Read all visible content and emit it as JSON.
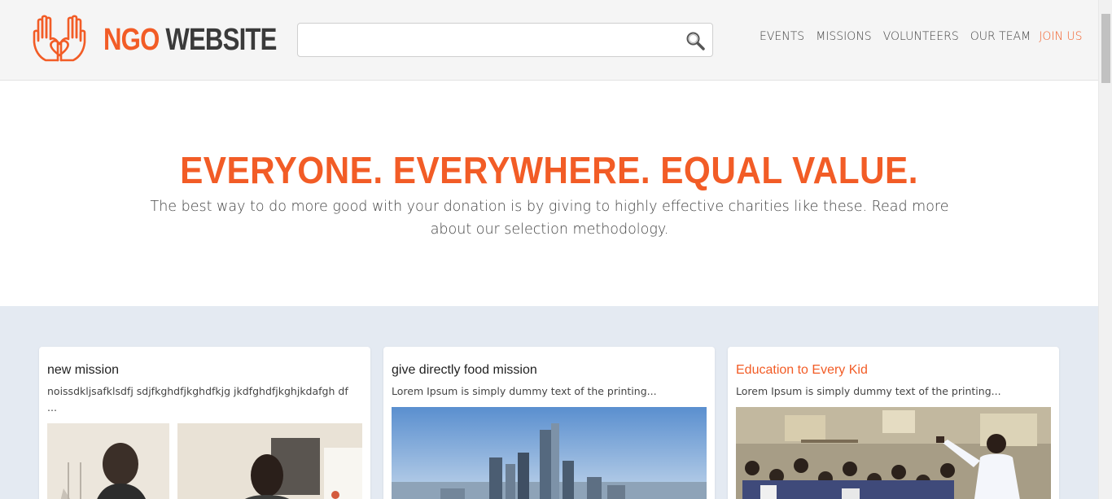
{
  "brand": {
    "part1": "NGO",
    "part2": "WEBSITE"
  },
  "search": {
    "placeholder": "",
    "value": ""
  },
  "nav": {
    "items": [
      "EVENTS",
      "MISSIONS",
      "VOLUNTEERS",
      "OUR TEAM"
    ],
    "cta": "JOIN US"
  },
  "hero": {
    "title": "EVERYONE. EVERYWHERE. EQUAL VALUE.",
    "subtitle": "The best way to do more good with your donation is by giving to highly effective charities like these. Read more about our selection methodology."
  },
  "cards": [
    {
      "title": "new mission",
      "text": "noissdkljsafklsdfj sdjfkghdfjkghdfkjg jkdfghdfjkghjkdafgh df ..."
    },
    {
      "title": "give directly food mission",
      "text": "Lorem Ipsum is simply dummy text of the printing..."
    },
    {
      "title": "Education to Every Kid",
      "text": "Lorem Ipsum is simply dummy text of the printing..."
    }
  ],
  "colors": {
    "accent": "#f25c26",
    "section_bg": "#e4eaf2",
    "header_bg": "#f5f5f5"
  }
}
